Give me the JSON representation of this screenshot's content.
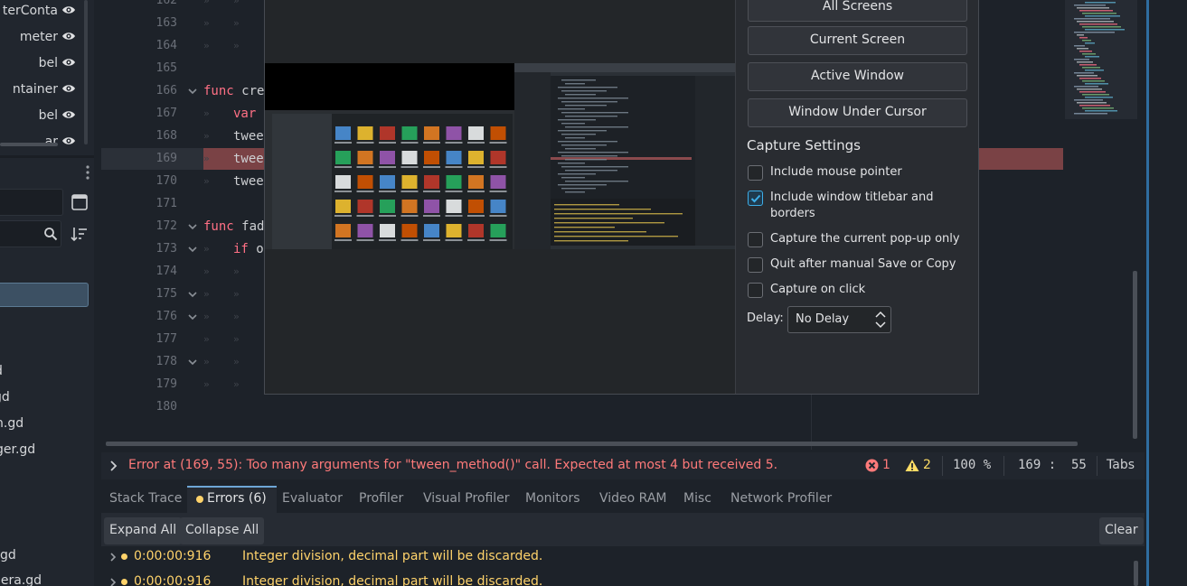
{
  "scene_tree": {
    "rows": [
      {
        "label": "terConta"
      },
      {
        "label": "meter"
      },
      {
        "label": "bel"
      },
      {
        "label": "ntainer"
      },
      {
        "label": "bel"
      },
      {
        "label": "ar"
      }
    ]
  },
  "filesystem": {
    "items": [
      "d",
      "gd",
      "n.gd",
      "ger.gd",
      "gd",
      "nera.gd"
    ]
  },
  "editor": {
    "lines": [
      {
        "num": "162",
        "code": ""
      },
      {
        "num": "163",
        "code": ""
      },
      {
        "num": "164",
        "code": ""
      },
      {
        "num": "165",
        "code": ""
      },
      {
        "num": "166",
        "kw": "func",
        "code": " cre"
      },
      {
        "num": "167",
        "kw": "var",
        "code": " ",
        "indent": 1
      },
      {
        "num": "168",
        "code": "twee",
        "indent": 1
      },
      {
        "num": "169",
        "code": "twee",
        "indent": 1
      },
      {
        "num": "170",
        "code": "twee",
        "indent": 1
      },
      {
        "num": "171",
        "code": ""
      },
      {
        "num": "172",
        "kw": "func",
        "code": " fad"
      },
      {
        "num": "173",
        "kw": "if",
        "code": " o",
        "indent": 1
      },
      {
        "num": "174",
        "code": ""
      },
      {
        "num": "175",
        "code": ""
      },
      {
        "num": "176",
        "code": ""
      },
      {
        "num": "177",
        "code": ""
      },
      {
        "num": "178",
        "code": ""
      },
      {
        "num": "179",
        "code": ""
      },
      {
        "num": "180",
        "code": ""
      }
    ]
  },
  "status_bar": {
    "error_message": "Error at (169, 55): Too many arguments for \"tween_method()\" call. Expected at most 4 but received 5.",
    "error_count": "1",
    "warning_count": "2",
    "zoom": "100 %",
    "caret_position": "169 :  55",
    "indent_mode": "Tabs"
  },
  "bottom_panel": {
    "tabs": [
      "Stack Trace",
      "Errors (6)",
      "Evaluator",
      "Profiler",
      "Visual Profiler",
      "Monitors",
      "Video RAM",
      "Misc",
      "Network Profiler"
    ],
    "active_tab": "Errors (6)",
    "expand_all": "Expand All",
    "collapse_all": "Collapse All",
    "clear": "Clear",
    "log": [
      {
        "time": "0:00:00:916",
        "message": "Integer division, decimal part will be discarded."
      },
      {
        "time": "0:00:00:916",
        "message": "Integer division, decimal part will be discarded."
      }
    ]
  },
  "screenshot_tool": {
    "capture_buttons": [
      "All Screens",
      "Current Screen",
      "Active Window",
      "Window Under Cursor"
    ],
    "settings_title": "Capture Settings",
    "options": [
      {
        "label": "Include mouse pointer",
        "checked": false
      },
      {
        "label": "Include window titlebar and borders",
        "checked": true
      },
      {
        "label": "Capture the current pop-up only",
        "checked": false
      },
      {
        "label": "Quit after manual Save or Copy",
        "checked": false
      },
      {
        "label": "Capture on click",
        "checked": false
      }
    ],
    "delay_label": "Delay:",
    "delay_value": "No Delay"
  },
  "colors": {
    "error": "#ff7a7a",
    "warning": "#ffdd65",
    "keyword": "#ff7085",
    "accent": "#3daee9"
  }
}
